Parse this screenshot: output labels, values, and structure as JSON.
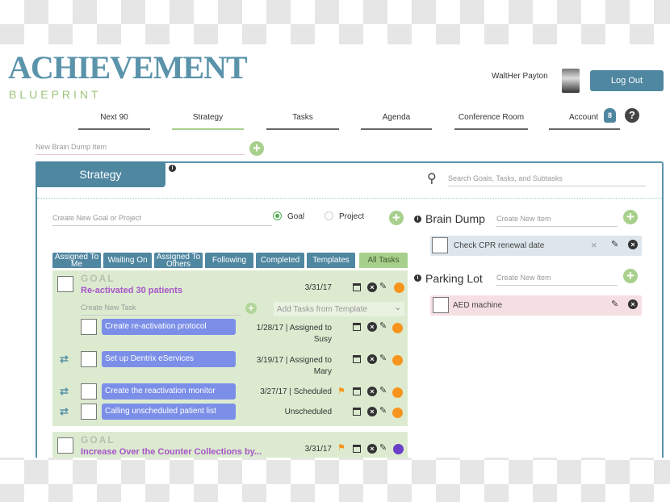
{
  "logo": {
    "main": "ACHIEVEMENT",
    "sub": "BLUEPRINT"
  },
  "header": {
    "user_name": "WaltHer Payton",
    "logout_label": "Log Out",
    "notification_count": "8",
    "help_label": "?"
  },
  "nav": [
    {
      "label": "Next 90"
    },
    {
      "label": "Strategy",
      "active": true
    },
    {
      "label": "Tasks"
    },
    {
      "label": "Agenda"
    },
    {
      "label": "Conference Room"
    },
    {
      "label": "Account"
    }
  ],
  "brain_dump_input": {
    "placeholder": "New Brain Dump Item"
  },
  "panel": {
    "tab_label": "Strategy",
    "search_placeholder": "Search Goals, Tasks, and Subtasks",
    "new_goal_placeholder": "Create New Goal or Project",
    "radio_goal": "Goal",
    "radio_project": "Project",
    "selected_type": "Goal"
  },
  "filters": [
    "Assigned To Me",
    "Waiting On",
    "Assigned To Others",
    "Following",
    "Completed",
    "Templates",
    "All Tasks"
  ],
  "active_filter": "All Tasks",
  "goals": [
    {
      "label": "GOAL",
      "title": "Re-activated 30 patients",
      "date": "3/31/17",
      "status_color": "#f7941d",
      "new_task_placeholder": "Create New Task",
      "template_placeholder": "Add Tasks from Template",
      "tasks": [
        {
          "title": "Create re-activation protocol",
          "meta": "1/28/17 | Assigned to",
          "meta2": "Susy",
          "status_color": "#f7941d"
        },
        {
          "title": "Set up Dentrix eServices",
          "meta": "3/19/17 | Assigned to",
          "meta2": "Mary",
          "status_color": "#f7941d"
        },
        {
          "title": "Create the reactivation monitor",
          "meta": "3/27/17 | Scheduled",
          "flag": true,
          "status_color": "#f7941d"
        },
        {
          "title": "Calling unscheduled patient list",
          "meta": "Unscheduled",
          "status_color": "#f7941d"
        }
      ]
    },
    {
      "label": "GOAL",
      "title": "Increase Over the Counter Collections by...",
      "date": "3/31/17",
      "flag": true,
      "status_color": "#6a3fc8"
    }
  ],
  "brain_dump": {
    "title": "Brain Dump",
    "placeholder": "Create New Item",
    "items": [
      {
        "text": "Check CPR renewal date"
      }
    ]
  },
  "parking_lot": {
    "title": "Parking Lot",
    "placeholder": "Create New Item",
    "items": [
      {
        "text": "AED machine"
      }
    ]
  },
  "colors": {
    "primary": "#4f86a0",
    "accent_green": "#a8d08d",
    "goal_bg": "#dcebd0",
    "task_bg": "#7b8fe8"
  }
}
